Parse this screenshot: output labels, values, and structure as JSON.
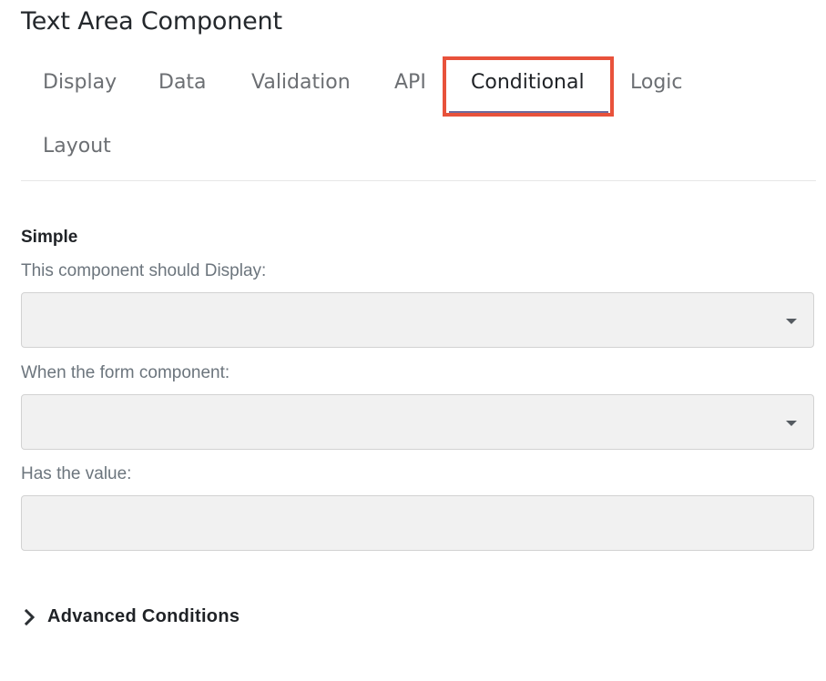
{
  "title": "Text Area Component",
  "tabs": [
    {
      "label": "Display"
    },
    {
      "label": "Data"
    },
    {
      "label": "Validation"
    },
    {
      "label": "API"
    },
    {
      "label": "Conditional",
      "active": true
    },
    {
      "label": "Logic"
    },
    {
      "label": "Layout"
    }
  ],
  "simple": {
    "heading": "Simple",
    "display_label": "This component should Display:",
    "display_value": "",
    "when_label": "When the form component:",
    "when_value": "",
    "value_label": "Has the value:",
    "value_value": ""
  },
  "advanced": {
    "label": "Advanced Conditions"
  },
  "colors": {
    "highlight": "#e8523b",
    "active_underline": "#6d6a9c",
    "field_bg": "#f1f1f1"
  }
}
